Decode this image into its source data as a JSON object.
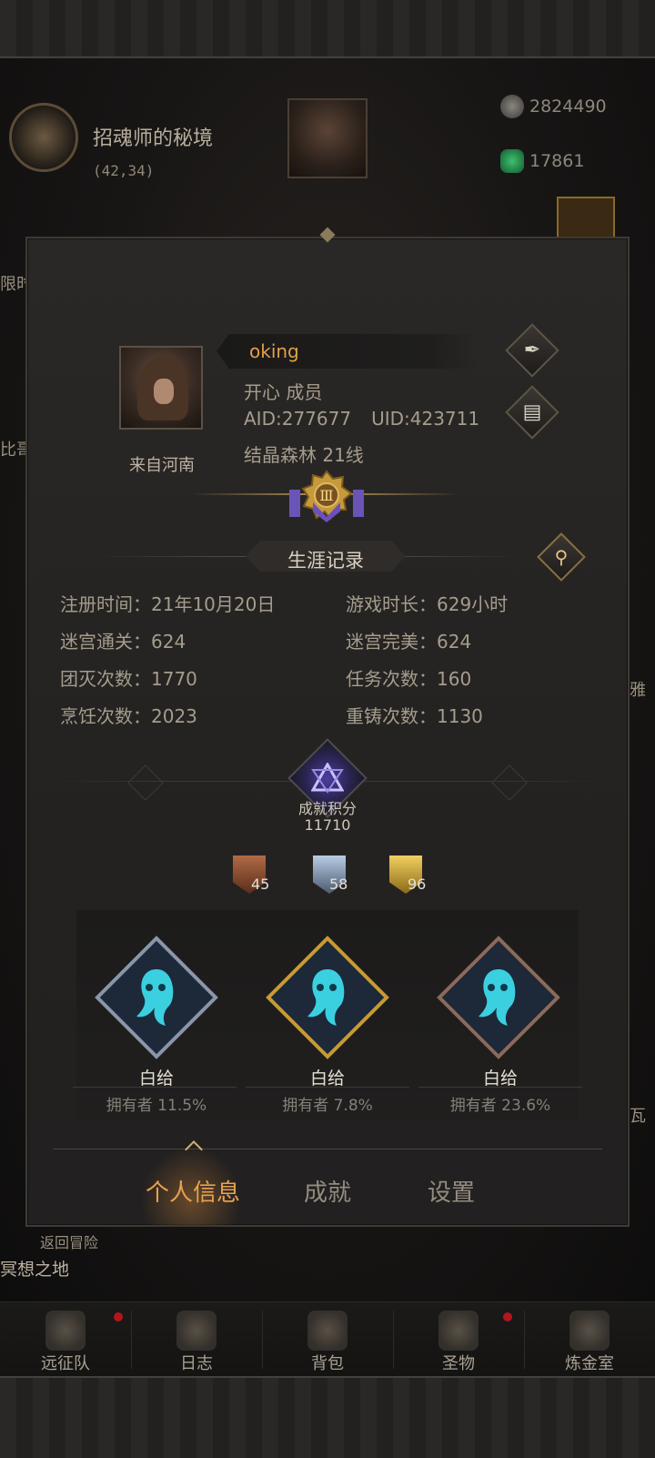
{
  "location": {
    "title": "招魂师的秘境",
    "coords": "(42,34)"
  },
  "resources": [
    {
      "icon": "stone-icon",
      "value": "2824490"
    },
    {
      "icon": "green-gem-icon",
      "value": "17861"
    }
  ],
  "side_fragments": {
    "left_1": "限时",
    "left_2": "比哥",
    "right_1": "雅",
    "right_2": "瓦",
    "return": "返回冒险",
    "area": "冥想之地"
  },
  "profile": {
    "name": "oking",
    "role": "开心 成员",
    "aid": "AID:277677",
    "uid": "UID:423711",
    "server": "结晶森林 21线",
    "from": "来自河南",
    "rank_numeral": "Ⅲ"
  },
  "career": {
    "title": "生涯记录",
    "stats": [
      {
        "label": "注册时间：",
        "value": "21年10月20日"
      },
      {
        "label": "游戏时长：",
        "value": "629小时"
      },
      {
        "label": "迷宫通关：",
        "value": "624"
      },
      {
        "label": "迷宫完美：",
        "value": "624"
      },
      {
        "label": "团灭次数：",
        "value": "1770"
      },
      {
        "label": "任务次数：",
        "value": "160"
      },
      {
        "label": "烹饪次数：",
        "value": "2023"
      },
      {
        "label": "重铸次数：",
        "value": "1130"
      }
    ]
  },
  "achievement": {
    "label": "成就积分",
    "score": "11710",
    "medals": [
      {
        "tier": "bronze",
        "count": "45",
        "color": "#b06a46"
      },
      {
        "tier": "silver",
        "count": "58",
        "color": "#8aa6c8"
      },
      {
        "tier": "gold",
        "count": "96",
        "color": "#d8b040"
      }
    ],
    "badges": [
      {
        "name": "白给",
        "owners": "拥有者 11.5%",
        "frame": "#8a96a8"
      },
      {
        "name": "白给",
        "owners": "拥有者 7.8%",
        "frame": "#c89a32"
      },
      {
        "name": "白给",
        "owners": "拥有者 23.6%",
        "frame": "#8a6a5a"
      }
    ]
  },
  "tabs": [
    {
      "label": "个人信息",
      "active": true
    },
    {
      "label": "成就",
      "active": false
    },
    {
      "label": "设置",
      "active": false
    }
  ],
  "nav": [
    {
      "label": "远征队",
      "icon": "helmet-icon",
      "badge": false
    },
    {
      "label": "日志",
      "icon": "scroll-icon",
      "badge": true
    },
    {
      "label": "背包",
      "icon": "bag-icon",
      "badge": false
    },
    {
      "label": "圣物",
      "icon": "chalice-icon",
      "badge": true
    },
    {
      "label": "炼金室",
      "icon": "alchemy-icon",
      "badge": false
    }
  ],
  "colors": {
    "accent_orange": "#e0a04a",
    "active_tab": "#e8a050",
    "notification": "#b2151d"
  }
}
